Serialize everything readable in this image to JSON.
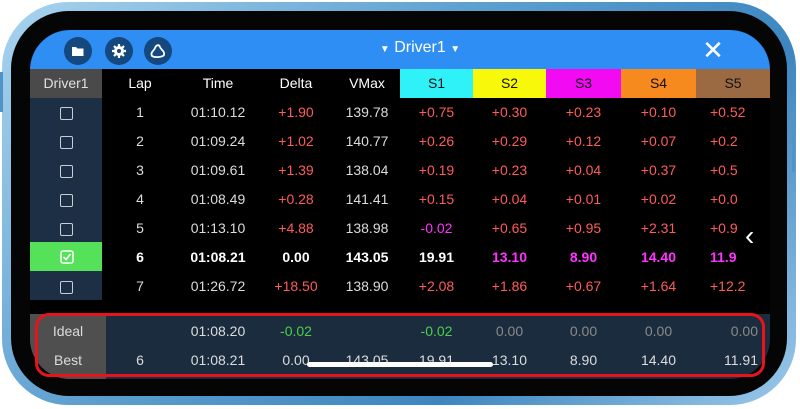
{
  "window": {
    "title": "Driver1",
    "close_label": "✕"
  },
  "toolbar": {
    "folder_icon": "folder-icon",
    "settings_icon": "gear-icon",
    "track_icon": "track-map-icon"
  },
  "colors": {
    "s1": "#2ef2f7",
    "s2": "#f8f80a",
    "s3": "#f20af2",
    "s4": "#f78a1f",
    "s5": "#9b6a43",
    "best_row_check": "#55e25a"
  },
  "headers": [
    "Driver1",
    "Lap",
    "Time",
    "Delta",
    "VMax",
    "S1",
    "S2",
    "S3",
    "S4",
    "S5"
  ],
  "rows": [
    {
      "checked": false,
      "lap": "1",
      "time": "01:10.12",
      "delta": "+1.90",
      "vmax": "139.78",
      "s1": "+0.75",
      "s2": "+0.30",
      "s3": "+0.23",
      "s4": "+0.10",
      "s5": "+0.52"
    },
    {
      "checked": false,
      "lap": "2",
      "time": "01:09.24",
      "delta": "+1.02",
      "vmax": "140.77",
      "s1": "+0.26",
      "s2": "+0.29",
      "s3": "+0.12",
      "s4": "+0.07",
      "s5": "+0.2"
    },
    {
      "checked": false,
      "lap": "3",
      "time": "01:09.61",
      "delta": "+1.39",
      "vmax": "138.04",
      "s1": "+0.19",
      "s2": "+0.23",
      "s3": "+0.04",
      "s4": "+0.37",
      "s5": "+0.5"
    },
    {
      "checked": false,
      "lap": "4",
      "time": "01:08.49",
      "delta": "+0.28",
      "vmax": "141.41",
      "s1": "+0.15",
      "s2": "+0.04",
      "s3": "+0.01",
      "s4": "+0.02",
      "s5": "+0.0"
    },
    {
      "checked": false,
      "lap": "5",
      "time": "01:13.10",
      "delta": "+4.88",
      "vmax": "138.98",
      "s1": "-0.02",
      "s2": "+0.65",
      "s3": "+0.95",
      "s4": "+2.31",
      "s5": "+0.9"
    },
    {
      "checked": true,
      "lap": "6",
      "time": "01:08.21",
      "delta": "0.00",
      "vmax": "143.05",
      "s1": "19.91",
      "s2": "13.10",
      "s3": "8.90",
      "s4": "14.40",
      "s5": "11.9"
    },
    {
      "checked": false,
      "lap": "7",
      "time": "01:26.72",
      "delta": "+18.50",
      "vmax": "138.90",
      "s1": "+2.08",
      "s2": "+1.86",
      "s3": "+0.67",
      "s4": "+1.64",
      "s5": "+12.2"
    }
  ],
  "summary": {
    "ideal": {
      "label": "Ideal",
      "lap": "",
      "time": "01:08.20",
      "delta": "-0.02",
      "vmax": "",
      "s1": "-0.02",
      "s2": "0.00",
      "s3": "0.00",
      "s4": "0.00",
      "s5": "0.00"
    },
    "best": {
      "label": "Best",
      "lap": "6",
      "time": "01:08.21",
      "delta": "0.00",
      "vmax": "143.05",
      "s1": "19.91",
      "s2": "13.10",
      "s3": "8.90",
      "s4": "14.40",
      "s5": "11.91"
    }
  }
}
